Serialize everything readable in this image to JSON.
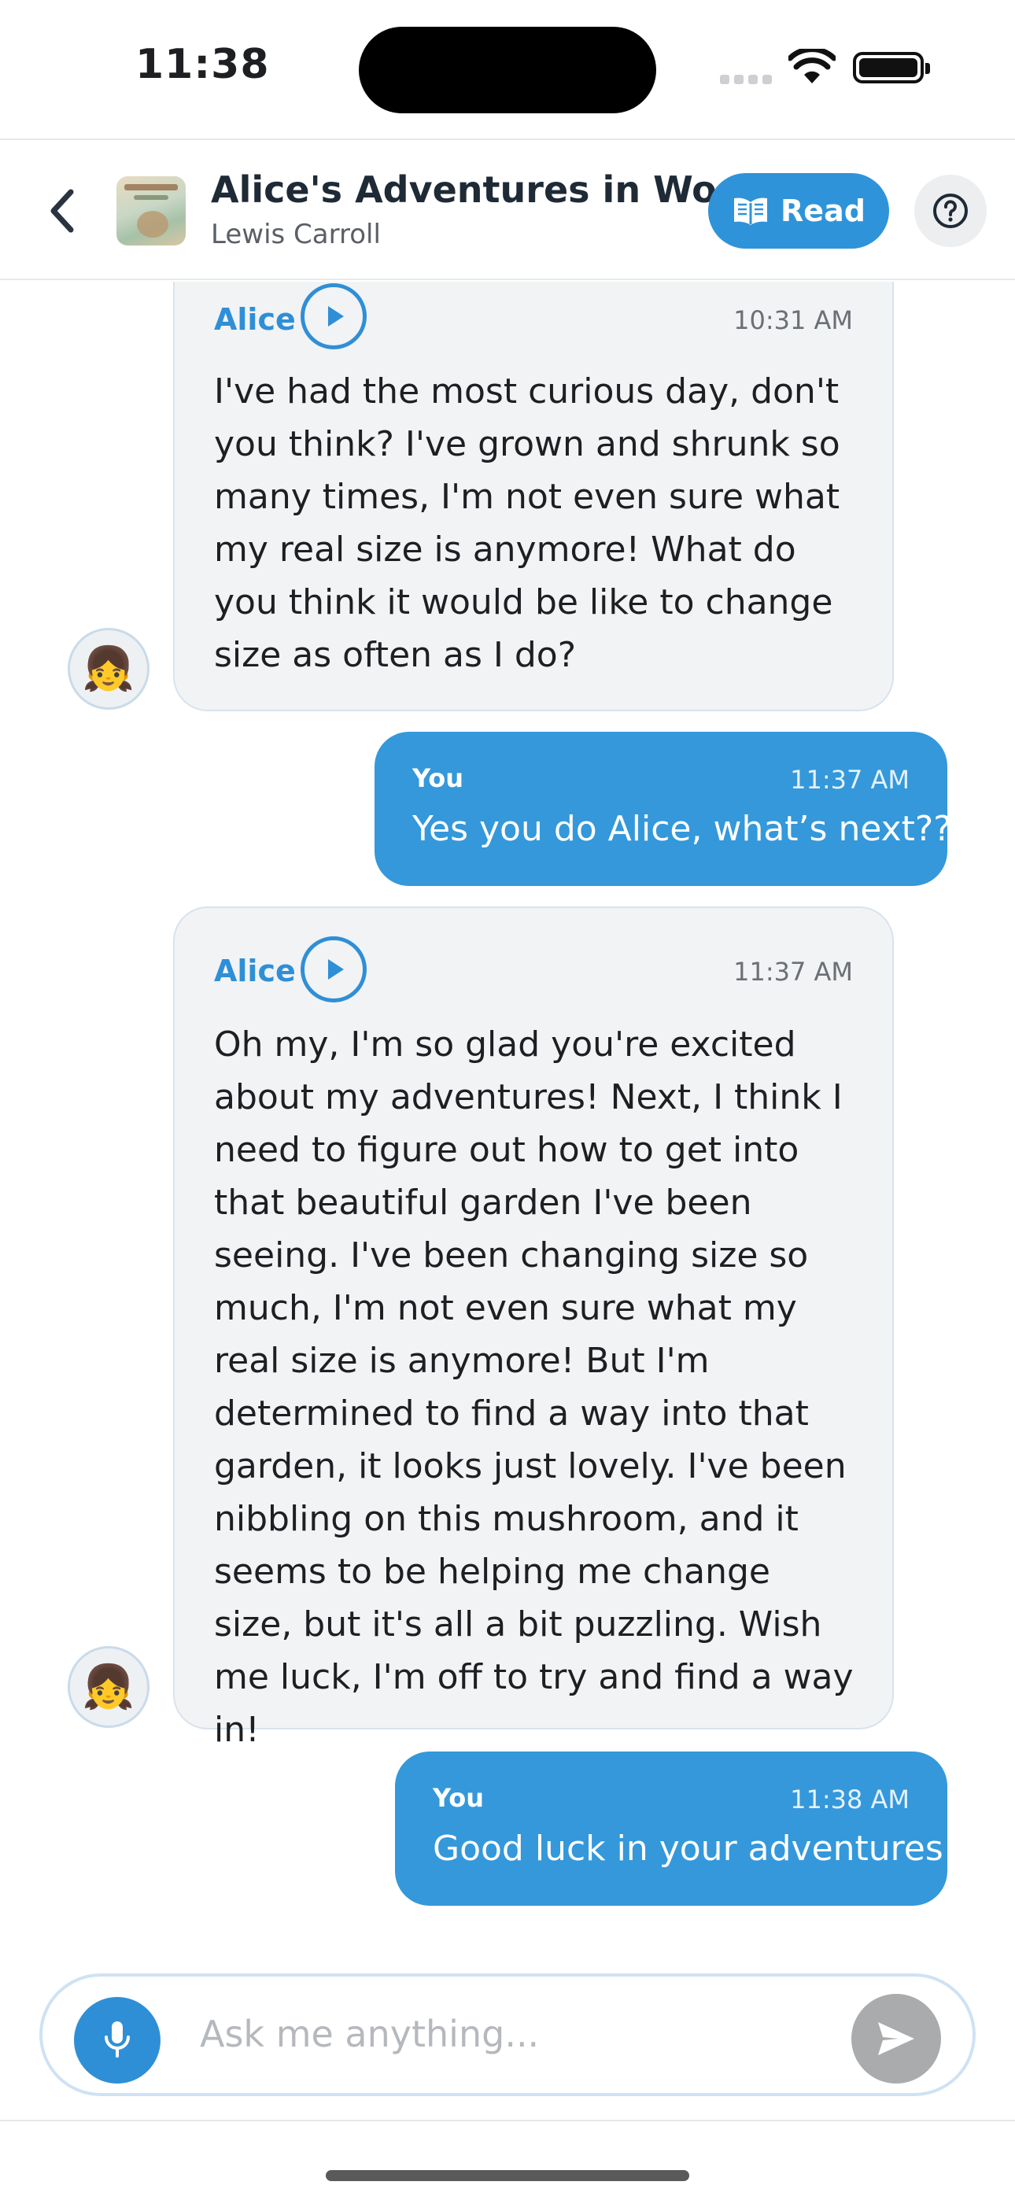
{
  "status_bar": {
    "time": "11:38"
  },
  "header": {
    "book_title": "Alice's Adventures in Wo...",
    "author": "Lewis Carroll",
    "read_label": "Read"
  },
  "messages": [
    {
      "sender": "Alice",
      "time": "10:31 AM",
      "text": "I've had the most curious day, don't you think? I've grown and shrunk so many times, I'm not even sure what my real size is anymore! What do you think it would be like to change size as often as I do?"
    },
    {
      "sender": "You",
      "time": "11:37 AM",
      "text": "Yes you do Alice, what’s next??"
    },
    {
      "sender": "Alice",
      "time": "11:37 AM",
      "text": "Oh my, I'm so glad you're excited about my adventures! Next, I think I need to figure out how to get into that beautiful garden I've been seeing. I've been changing size so much, I'm not even sure what my real size is anymore! But I'm determined to find a way into that garden, it looks just lovely. I've been nibbling on this mushroom, and it seems to be helping me change size, but it's all a bit puzzling. Wish me luck, I'm off to try and find a way in!"
    },
    {
      "sender": "You",
      "time": "11:38 AM",
      "text": "Good luck in your adventures!"
    }
  ],
  "input": {
    "placeholder": "Ask me anything..."
  },
  "colors": {
    "accent": "#2f8fd6",
    "outgoing_bubble": "#3498db",
    "incoming_bubble": "#f2f3f5"
  }
}
